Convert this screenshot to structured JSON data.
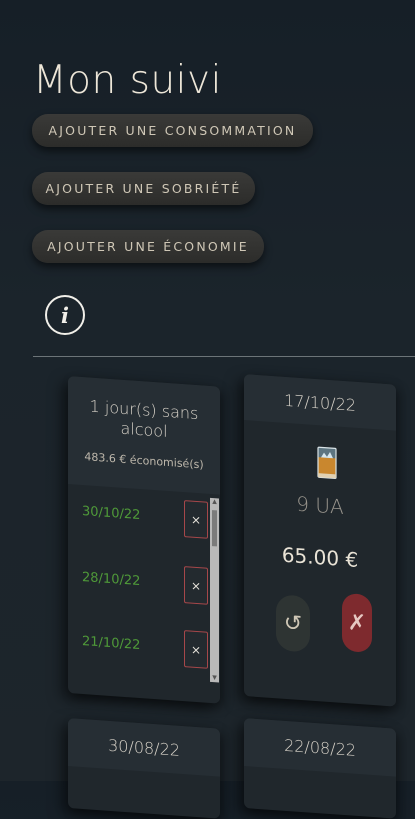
{
  "page": {
    "title": "Mon suivi"
  },
  "actions": {
    "add_consumption": "AJOUTER UNE CONSOMMATION",
    "add_sobriety": "AJOUTER UNE SOBRIÉTÉ",
    "add_saving": "AJOUTER UNE ÉCONOMIE"
  },
  "info": {
    "glyph": "i",
    "icon": "info-icon"
  },
  "streak_card": {
    "title": "1 jour(s) sans alcool",
    "saved": "483.6 € économisé(s)",
    "entries": [
      {
        "date": "30/10/22",
        "delete": "×"
      },
      {
        "date": "28/10/22",
        "delete": "×"
      },
      {
        "date": "21/10/22",
        "delete": "×"
      }
    ],
    "scroll_up": "▲",
    "scroll_down": "▼"
  },
  "drink_card": {
    "date": "17/10/22",
    "icon": "whisky-glass-icon",
    "units": "9 UA",
    "price": "65.00 €",
    "undo_glyph": "↺",
    "delete_glyph": "✗"
  },
  "more_cards": [
    {
      "date": "30/08/22"
    },
    {
      "date": "22/08/22"
    }
  ],
  "colors": {
    "background": "#1b242b",
    "success_text": "#4f9a39",
    "danger": "#7e2a2e",
    "delete_border": "#a6474a"
  }
}
